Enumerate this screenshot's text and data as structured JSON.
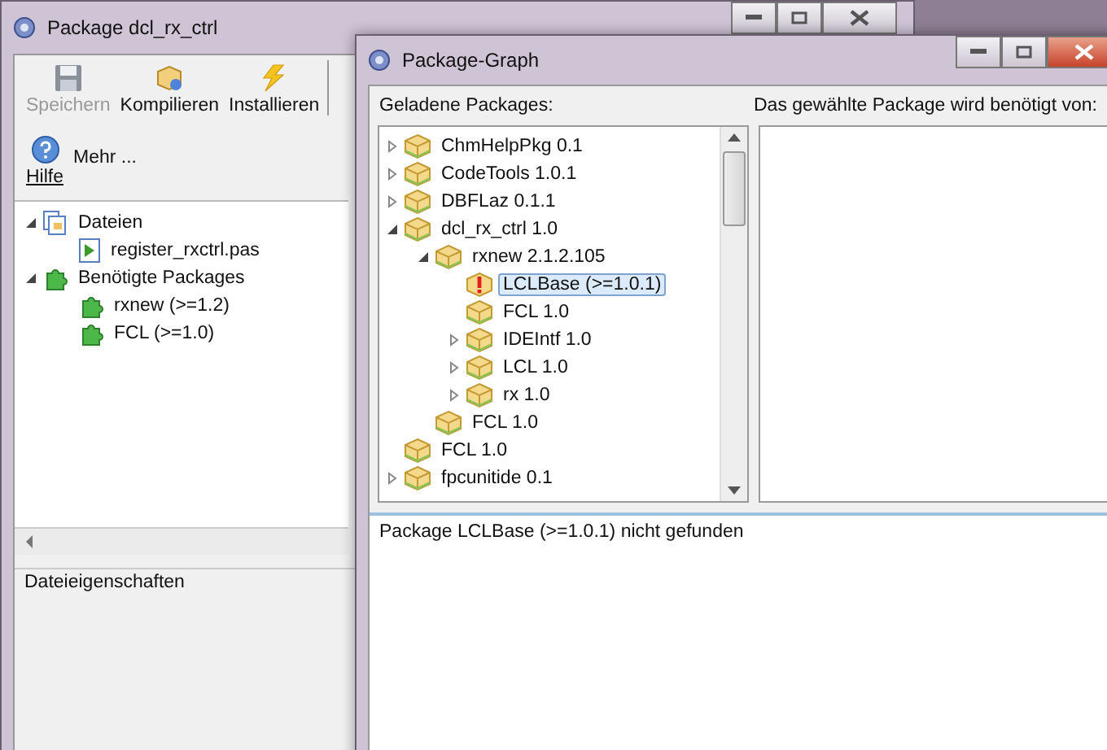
{
  "package_window": {
    "title": "Package dcl_rx_ctrl",
    "toolbar": [
      {
        "label": "Speichern",
        "kind": "save",
        "disabled": true
      },
      {
        "label": "Kompilieren",
        "kind": "compile",
        "disabled": false
      },
      {
        "label": "Installieren",
        "kind": "install",
        "disabled": false
      }
    ],
    "help_button": {
      "label": "Hilfe"
    },
    "more_button": {
      "label": "Mehr ..."
    },
    "tree": [
      {
        "label": "Dateien",
        "kind": "files",
        "expanded": true,
        "children": [
          {
            "label": "register_rxctrl.pas",
            "kind": "unit"
          }
        ]
      },
      {
        "label": "Benötigte Packages",
        "kind": "requirement",
        "expanded": true,
        "children": [
          {
            "label": "rxnew (>=1.2)",
            "kind": "requirement"
          },
          {
            "label": "FCL (>=1.0)",
            "kind": "requirement"
          }
        ]
      }
    ],
    "properties_label": "Dateieigenschaften"
  },
  "graph_window": {
    "title": "Package-Graph",
    "loaded_label": "Geladene Packages:",
    "required_by_label": "Das gewählte Package wird benötigt von:",
    "tree": [
      {
        "label": "ChmHelpPkg 0.1",
        "missing": false,
        "expanded": false,
        "selected": false
      },
      {
        "label": "CodeTools 1.0.1",
        "missing": false,
        "expanded": false,
        "selected": false
      },
      {
        "label": "DBFLaz 0.1.1",
        "missing": false,
        "expanded": false,
        "selected": false
      },
      {
        "label": "dcl_rx_ctrl 1.0",
        "missing": false,
        "expanded": true,
        "selected": false,
        "children": [
          {
            "label": "rxnew 2.1.2.105",
            "missing": false,
            "expanded": true,
            "selected": false,
            "children": [
              {
                "label": "LCLBase (>=1.0.1)",
                "missing": true,
                "selected": true
              },
              {
                "label": "FCL 1.0",
                "missing": false,
                "selected": false
              },
              {
                "label": "IDEIntf 1.0",
                "missing": false,
                "expanded": false,
                "selected": false
              },
              {
                "label": "LCL 1.0",
                "missing": false,
                "expanded": false,
                "selected": false
              },
              {
                "label": "rx 1.0",
                "missing": false,
                "expanded": false,
                "selected": false
              }
            ]
          },
          {
            "label": "FCL 1.0",
            "missing": false,
            "selected": false
          }
        ]
      },
      {
        "label": "FCL 1.0",
        "missing": false,
        "selected": false
      },
      {
        "label": "fpcunitide 0.1",
        "missing": false,
        "expanded": false,
        "selected": false
      }
    ],
    "message": "Package LCLBase (>=1.0.1) nicht gefunden"
  }
}
